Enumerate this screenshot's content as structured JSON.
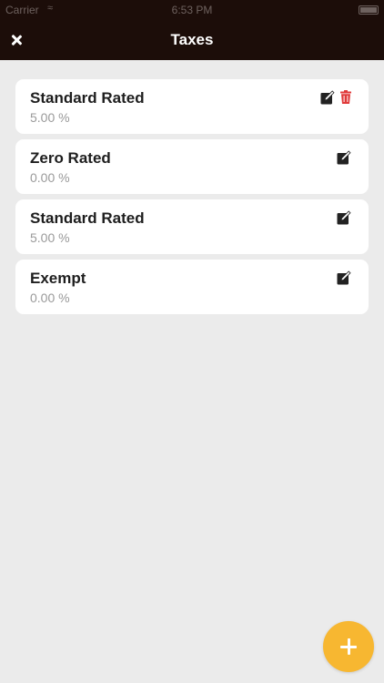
{
  "status_bar": {
    "carrier": "Carrier",
    "wifi_icon": "wifi-icon",
    "time": "6:53 PM",
    "battery_icon": "battery-icon"
  },
  "header": {
    "title": "Taxes",
    "close_icon": "close-icon"
  },
  "taxes": [
    {
      "name": "Standard Rated",
      "rate": "5.00 %",
      "deletable": true
    },
    {
      "name": "Zero Rated",
      "rate": "0.00 %",
      "deletable": false
    },
    {
      "name": "Standard Rated",
      "rate": "5.00 %",
      "deletable": false
    },
    {
      "name": "Exempt",
      "rate": "0.00 %",
      "deletable": false
    }
  ],
  "colors": {
    "header_bg": "#1c0d09",
    "page_bg": "#ebebeb",
    "fab": "#f7b731",
    "delete": "#e03a3a"
  },
  "fab": {
    "icon": "plus-icon"
  }
}
